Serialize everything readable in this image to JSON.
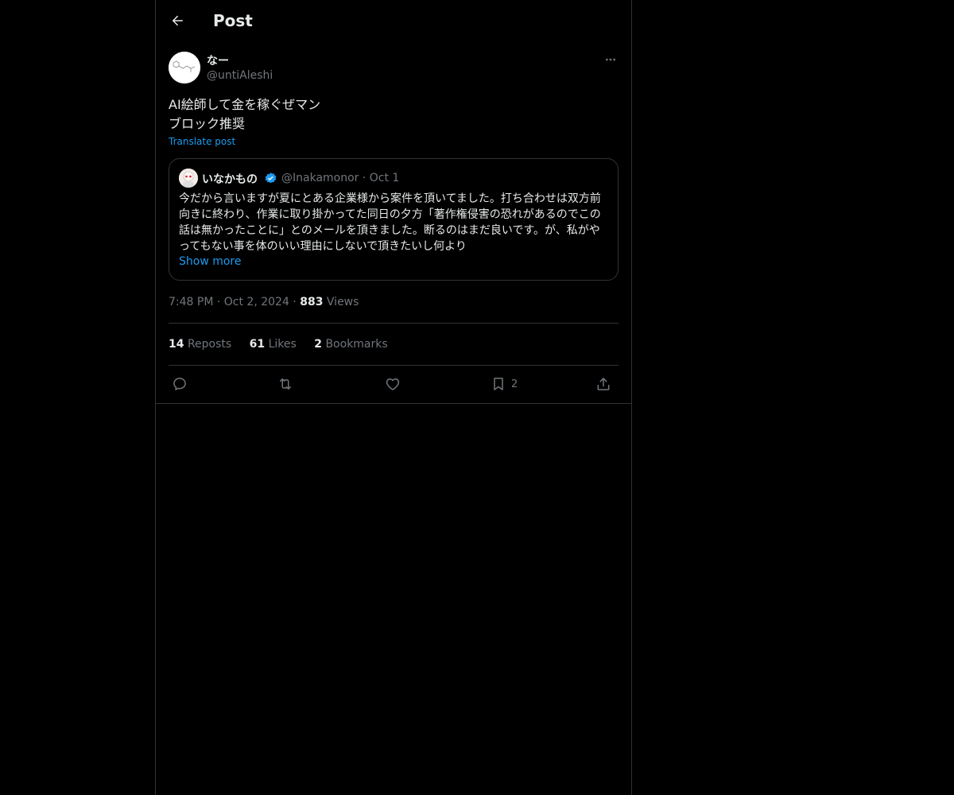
{
  "header": {
    "title": "Post",
    "back_icon": "arrow-left-icon"
  },
  "post": {
    "author_name": "なー",
    "author_handle": "@untiAleshi",
    "text_line1": "AI絵師して金を稼ぐぜマン",
    "text_line2": "ブロック推奨",
    "translate_label": "Translate post",
    "timestamp": "7:48 PM · Oct 2, 2024 ·",
    "views_count": "883",
    "views_label": "Views"
  },
  "quote": {
    "author_name": "いなかもの",
    "author_handle": "@Inakamonor · Oct 1",
    "text": "今だから言いますが夏にとある企業様から案件を頂いてました。打ち合わせは双方前向きに終わり、作業に取り掛かってた同日の夕方「著作権侵害の恐れがあるのでこの話は無かったことに」とのメールを頂きました。断るのはまだ良いです。が、私がやってもない事を体のいい理由にしないで頂きたいし何より",
    "show_more_label": "Show more"
  },
  "stats": {
    "reposts_count": "14",
    "reposts_label": "Reposts",
    "likes_count": "61",
    "likes_label": "Likes",
    "bookmarks_count": "2",
    "bookmarks_label": "Bookmarks"
  },
  "actions": {
    "bookmark_count": "2"
  },
  "colors": {
    "background": "#000000",
    "text": "#e7e9ea",
    "muted": "#71767b",
    "accent": "#1d9bf0",
    "border": "#2f3336"
  }
}
